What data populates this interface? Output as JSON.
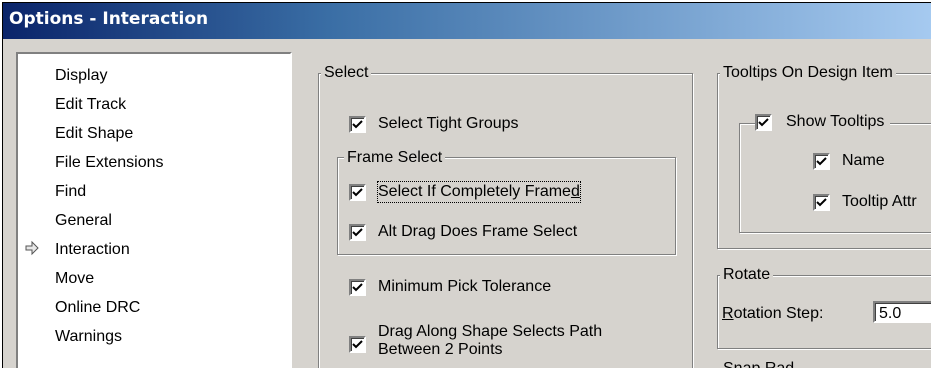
{
  "window": {
    "title": "Options - Interaction"
  },
  "tree": {
    "items": [
      {
        "label": "Display"
      },
      {
        "label": "Edit Track"
      },
      {
        "label": "Edit Shape"
      },
      {
        "label": "File Extensions"
      },
      {
        "label": "Find"
      },
      {
        "label": "General"
      },
      {
        "label": "Interaction",
        "selected": true
      },
      {
        "label": "Move"
      },
      {
        "label": "Online DRC"
      },
      {
        "label": "Warnings"
      }
    ],
    "selected_icon": "right-arrow-icon"
  },
  "select_group": {
    "title": "Select",
    "select_tight_groups": {
      "label": "Select Tight Groups",
      "checked": true
    },
    "frame_select": {
      "title": "Frame Select",
      "completely_framed": {
        "label_pre": "Select If Completely Frame",
        "label_u": "d",
        "checked": true
      },
      "alt_drag": {
        "label": "Alt Drag Does Frame Select",
        "checked": true
      }
    },
    "min_pick": {
      "label": "Minimum Pick Tolerance",
      "checked": true
    },
    "drag_along": {
      "line1": "Drag Along Shape Selects Path",
      "line2": "Between 2 Points",
      "checked": true
    }
  },
  "tooltips_group": {
    "title": "Tooltips On Design Item",
    "show_tooltips": {
      "label": "Show Tooltips",
      "checked": true
    },
    "name": {
      "label": "Name",
      "checked": true
    },
    "tooltip_attr": {
      "label": "Tooltip Attr",
      "checked": true
    }
  },
  "rotate_group": {
    "title": "Rotate",
    "rotation_step_label_u": "R",
    "rotation_step_label_rest": "otation Step:",
    "rotation_step_value": "5.0"
  },
  "next_group": {
    "title": "Snap Rad"
  },
  "colors": {
    "title_start": "#0a246a",
    "title_end": "#a6caf0",
    "face": "#d6d3ce"
  }
}
